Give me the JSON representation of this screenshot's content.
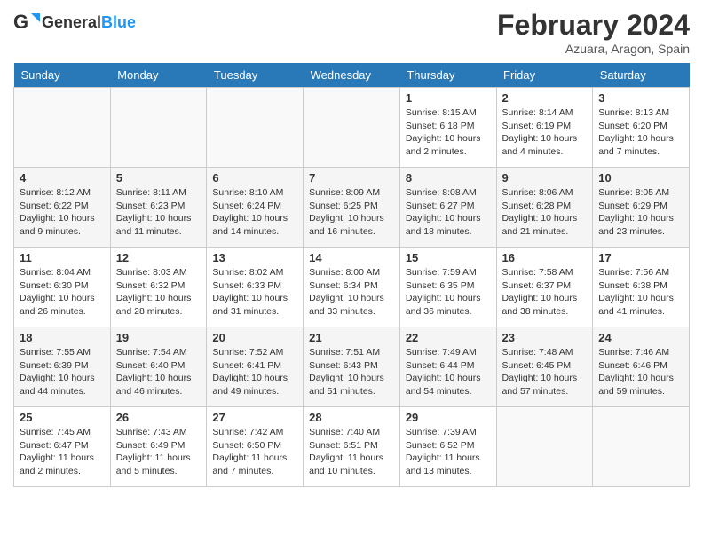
{
  "header": {
    "logo_general": "General",
    "logo_blue": "Blue",
    "month_title": "February 2024",
    "location": "Azuara, Aragon, Spain"
  },
  "weekdays": [
    "Sunday",
    "Monday",
    "Tuesday",
    "Wednesday",
    "Thursday",
    "Friday",
    "Saturday"
  ],
  "weeks": [
    [
      {
        "day": "",
        "info": ""
      },
      {
        "day": "",
        "info": ""
      },
      {
        "day": "",
        "info": ""
      },
      {
        "day": "",
        "info": ""
      },
      {
        "day": "1",
        "info": "Sunrise: 8:15 AM\nSunset: 6:18 PM\nDaylight: 10 hours\nand 2 minutes."
      },
      {
        "day": "2",
        "info": "Sunrise: 8:14 AM\nSunset: 6:19 PM\nDaylight: 10 hours\nand 4 minutes."
      },
      {
        "day": "3",
        "info": "Sunrise: 8:13 AM\nSunset: 6:20 PM\nDaylight: 10 hours\nand 7 minutes."
      }
    ],
    [
      {
        "day": "4",
        "info": "Sunrise: 8:12 AM\nSunset: 6:22 PM\nDaylight: 10 hours\nand 9 minutes."
      },
      {
        "day": "5",
        "info": "Sunrise: 8:11 AM\nSunset: 6:23 PM\nDaylight: 10 hours\nand 11 minutes."
      },
      {
        "day": "6",
        "info": "Sunrise: 8:10 AM\nSunset: 6:24 PM\nDaylight: 10 hours\nand 14 minutes."
      },
      {
        "day": "7",
        "info": "Sunrise: 8:09 AM\nSunset: 6:25 PM\nDaylight: 10 hours\nand 16 minutes."
      },
      {
        "day": "8",
        "info": "Sunrise: 8:08 AM\nSunset: 6:27 PM\nDaylight: 10 hours\nand 18 minutes."
      },
      {
        "day": "9",
        "info": "Sunrise: 8:06 AM\nSunset: 6:28 PM\nDaylight: 10 hours\nand 21 minutes."
      },
      {
        "day": "10",
        "info": "Sunrise: 8:05 AM\nSunset: 6:29 PM\nDaylight: 10 hours\nand 23 minutes."
      }
    ],
    [
      {
        "day": "11",
        "info": "Sunrise: 8:04 AM\nSunset: 6:30 PM\nDaylight: 10 hours\nand 26 minutes."
      },
      {
        "day": "12",
        "info": "Sunrise: 8:03 AM\nSunset: 6:32 PM\nDaylight: 10 hours\nand 28 minutes."
      },
      {
        "day": "13",
        "info": "Sunrise: 8:02 AM\nSunset: 6:33 PM\nDaylight: 10 hours\nand 31 minutes."
      },
      {
        "day": "14",
        "info": "Sunrise: 8:00 AM\nSunset: 6:34 PM\nDaylight: 10 hours\nand 33 minutes."
      },
      {
        "day": "15",
        "info": "Sunrise: 7:59 AM\nSunset: 6:35 PM\nDaylight: 10 hours\nand 36 minutes."
      },
      {
        "day": "16",
        "info": "Sunrise: 7:58 AM\nSunset: 6:37 PM\nDaylight: 10 hours\nand 38 minutes."
      },
      {
        "day": "17",
        "info": "Sunrise: 7:56 AM\nSunset: 6:38 PM\nDaylight: 10 hours\nand 41 minutes."
      }
    ],
    [
      {
        "day": "18",
        "info": "Sunrise: 7:55 AM\nSunset: 6:39 PM\nDaylight: 10 hours\nand 44 minutes."
      },
      {
        "day": "19",
        "info": "Sunrise: 7:54 AM\nSunset: 6:40 PM\nDaylight: 10 hours\nand 46 minutes."
      },
      {
        "day": "20",
        "info": "Sunrise: 7:52 AM\nSunset: 6:41 PM\nDaylight: 10 hours\nand 49 minutes."
      },
      {
        "day": "21",
        "info": "Sunrise: 7:51 AM\nSunset: 6:43 PM\nDaylight: 10 hours\nand 51 minutes."
      },
      {
        "day": "22",
        "info": "Sunrise: 7:49 AM\nSunset: 6:44 PM\nDaylight: 10 hours\nand 54 minutes."
      },
      {
        "day": "23",
        "info": "Sunrise: 7:48 AM\nSunset: 6:45 PM\nDaylight: 10 hours\nand 57 minutes."
      },
      {
        "day": "24",
        "info": "Sunrise: 7:46 AM\nSunset: 6:46 PM\nDaylight: 10 hours\nand 59 minutes."
      }
    ],
    [
      {
        "day": "25",
        "info": "Sunrise: 7:45 AM\nSunset: 6:47 PM\nDaylight: 11 hours\nand 2 minutes."
      },
      {
        "day": "26",
        "info": "Sunrise: 7:43 AM\nSunset: 6:49 PM\nDaylight: 11 hours\nand 5 minutes."
      },
      {
        "day": "27",
        "info": "Sunrise: 7:42 AM\nSunset: 6:50 PM\nDaylight: 11 hours\nand 7 minutes."
      },
      {
        "day": "28",
        "info": "Sunrise: 7:40 AM\nSunset: 6:51 PM\nDaylight: 11 hours\nand 10 minutes."
      },
      {
        "day": "29",
        "info": "Sunrise: 7:39 AM\nSunset: 6:52 PM\nDaylight: 11 hours\nand 13 minutes."
      },
      {
        "day": "",
        "info": ""
      },
      {
        "day": "",
        "info": ""
      }
    ]
  ]
}
